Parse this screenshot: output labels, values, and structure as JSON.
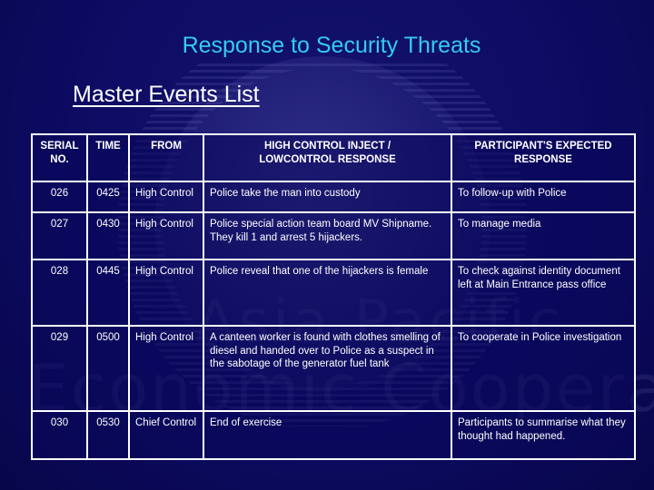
{
  "slide": {
    "title": "Response to Security Threats",
    "subtitle": "Master Events List",
    "watermark": {
      "line1": "Asia Pacific",
      "line2": "Economic Cooperation",
      "logo_icon": "globe-icon"
    },
    "colors": {
      "background": "#0d0b62",
      "title": "#33ccf0",
      "text": "#ffffff",
      "grid": "#ffffff"
    }
  },
  "table": {
    "headers": [
      "SERIAL NO.",
      "TIME",
      "FROM",
      "HIGH CONTROL INJECT / LOWCONTROL RESPONSE",
      "PARTICIPANT'S EXPECTED RESPONSE"
    ],
    "rows": [
      {
        "serial": "026",
        "time": "0425",
        "from": "High Control",
        "inject": "Police take the man into custody",
        "expected": "To follow-up with Police"
      },
      {
        "serial": "027",
        "time": "0430",
        "from": "High Control",
        "inject": "Police special action team board MV Shipname. They kill 1 and arrest 5 hijackers.",
        "expected": "To manage media"
      },
      {
        "serial": "028",
        "time": "0445",
        "from": "High Control",
        "inject": "Police reveal that one of the hijackers is female",
        "expected": "To check against identity document left at Main Entrance pass office"
      },
      {
        "serial": "029",
        "time": "0500",
        "from": "High Control",
        "inject": "A canteen worker is found with clothes smelling of diesel and handed over to Police as a suspect in the sabotage of the generator fuel tank",
        "expected": "To cooperate in Police investigation"
      },
      {
        "serial": "030",
        "time": "0530",
        "from": "Chief Control",
        "inject": "End of exercise",
        "expected": "Participants to summarise what they thought had happened."
      }
    ]
  }
}
